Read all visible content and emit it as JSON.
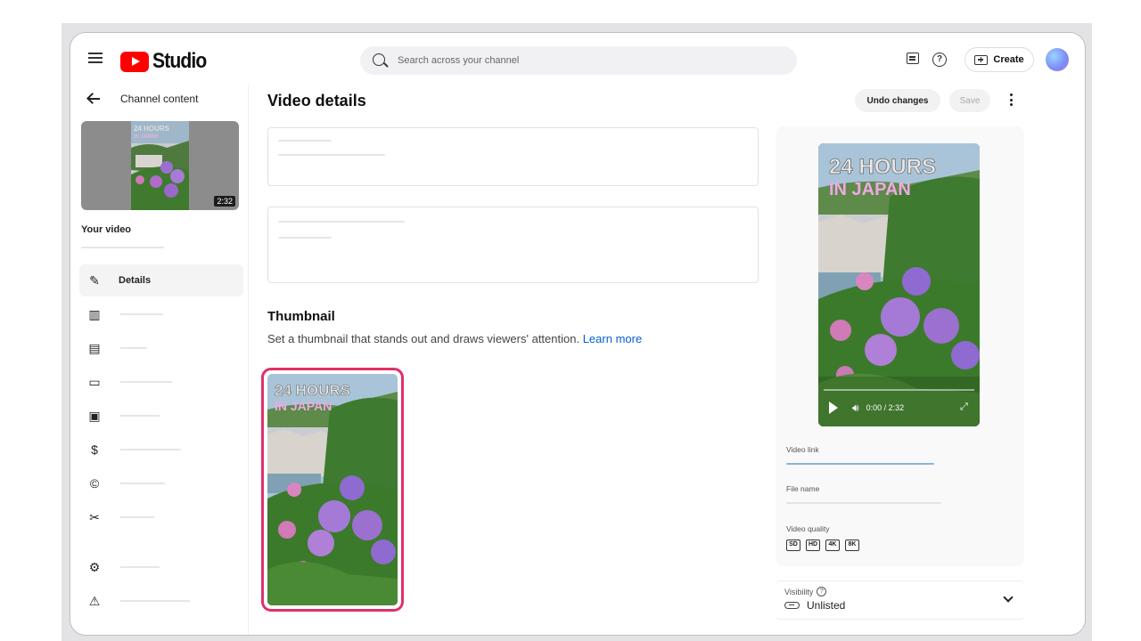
{
  "header": {
    "logo_text": "Studio",
    "search_placeholder": "Search across your channel",
    "create_label": "Create"
  },
  "sidebar": {
    "back_label": "Channel content",
    "thumb_duration": "2:32",
    "your_video_label": "Your video",
    "items": [
      {
        "label": "Details",
        "icon": "pencil-icon",
        "active": true
      },
      {
        "label": "",
        "icon": "analytics-icon"
      },
      {
        "label": "",
        "icon": "editor-icon"
      },
      {
        "label": "",
        "icon": "comments-icon"
      },
      {
        "label": "",
        "icon": "subtitles-icon"
      },
      {
        "label": "",
        "icon": "monetization-icon"
      },
      {
        "label": "",
        "icon": "copyright-icon"
      },
      {
        "label": "",
        "icon": "clips-icon"
      },
      {
        "label": "",
        "icon": "settings-icon"
      },
      {
        "label": "",
        "icon": "feedback-icon"
      }
    ]
  },
  "main": {
    "title": "Video details",
    "undo_label": "Undo changes",
    "save_label": "Save",
    "thumbnail_heading": "Thumbnail",
    "thumbnail_desc": "Set a thumbnail that stands out and draws viewers' attention.",
    "learn_more": "Learn more",
    "thumb_overlay_line1": "24 HOURS",
    "thumb_overlay_line2": "IN JAPAN"
  },
  "preview": {
    "overlay_line1": "24 HOURS",
    "overlay_line2": "IN JAPAN",
    "time": "0:00 / 2:32",
    "video_link_label": "Video link",
    "file_name_label": "File name",
    "video_quality_label": "Video quality",
    "quality_badges": [
      "SD",
      "HD",
      "4K",
      "8K"
    ]
  },
  "visibility": {
    "label": "Visibility",
    "value": "Unlisted"
  },
  "colors": {
    "accent_red": "#ff0000",
    "link_blue": "#065fd4",
    "thumb_border": "#e0306b",
    "video_link_line": "#8ab4d8"
  }
}
